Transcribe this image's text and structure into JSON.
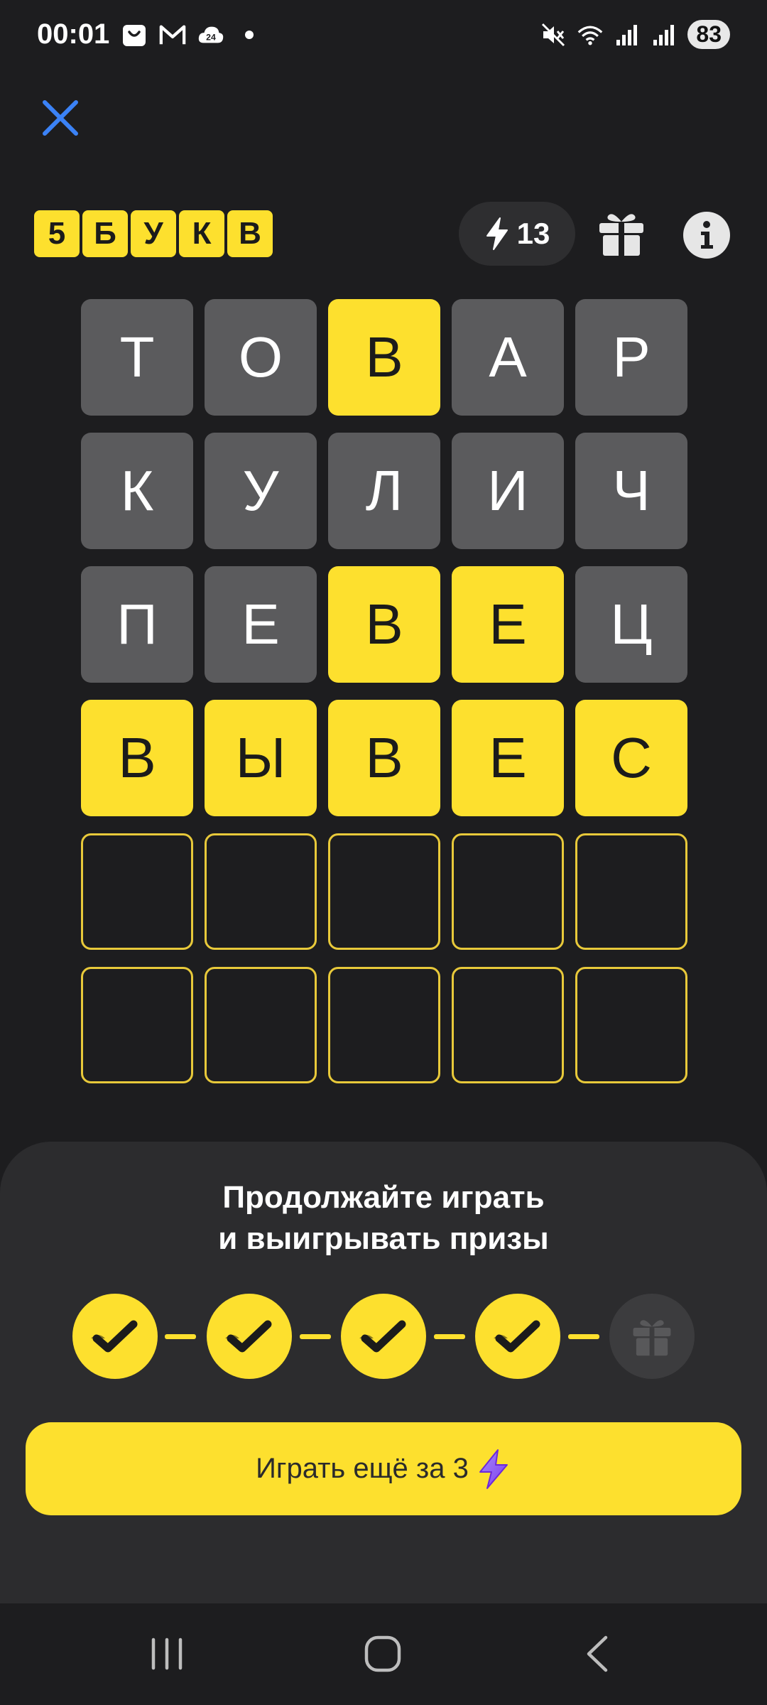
{
  "status": {
    "time": "00:01",
    "left_icons": [
      "shopping-bag-icon",
      "gmail-icon",
      "cloud-24-icon",
      "dot-icon"
    ],
    "right_icons": [
      "mute-icon",
      "wifi-icon",
      "signal-icon",
      "signal-icon"
    ],
    "battery": "83"
  },
  "header": {
    "logo_letters": [
      "5",
      "Б",
      "У",
      "К",
      "В"
    ],
    "energy_count": "13",
    "icons": [
      "close-icon",
      "lightning-icon",
      "gift-icon",
      "info-icon"
    ]
  },
  "grid": {
    "rows": [
      [
        {
          "letter": "Т",
          "state": "absent"
        },
        {
          "letter": "О",
          "state": "absent"
        },
        {
          "letter": "В",
          "state": "present"
        },
        {
          "letter": "А",
          "state": "absent"
        },
        {
          "letter": "Р",
          "state": "absent"
        }
      ],
      [
        {
          "letter": "К",
          "state": "absent"
        },
        {
          "letter": "У",
          "state": "absent"
        },
        {
          "letter": "Л",
          "state": "absent"
        },
        {
          "letter": "И",
          "state": "absent"
        },
        {
          "letter": "Ч",
          "state": "absent"
        }
      ],
      [
        {
          "letter": "П",
          "state": "absent"
        },
        {
          "letter": "Е",
          "state": "absent"
        },
        {
          "letter": "В",
          "state": "present"
        },
        {
          "letter": "Е",
          "state": "present"
        },
        {
          "letter": "Ц",
          "state": "absent"
        }
      ],
      [
        {
          "letter": "В",
          "state": "present"
        },
        {
          "letter": "Ы",
          "state": "present"
        },
        {
          "letter": "В",
          "state": "present"
        },
        {
          "letter": "Е",
          "state": "present"
        },
        {
          "letter": "С",
          "state": "present"
        }
      ],
      [
        {
          "letter": "",
          "state": "empty"
        },
        {
          "letter": "",
          "state": "empty"
        },
        {
          "letter": "",
          "state": "empty"
        },
        {
          "letter": "",
          "state": "empty"
        },
        {
          "letter": "",
          "state": "empty"
        }
      ],
      [
        {
          "letter": "",
          "state": "empty"
        },
        {
          "letter": "",
          "state": "empty"
        },
        {
          "letter": "",
          "state": "empty"
        },
        {
          "letter": "",
          "state": "empty"
        },
        {
          "letter": "",
          "state": "empty"
        }
      ]
    ]
  },
  "sheet": {
    "title_line1": "Продолжайте играть",
    "title_line2": "и выигрывать призы",
    "progress_steps": [
      "done",
      "done",
      "done",
      "done",
      "gift"
    ],
    "play_label": "Играть ещё за 3"
  },
  "colors": {
    "accent": "#fde02e",
    "tile_absent": "#5b5b5d",
    "background": "#1d1d1f",
    "sheet": "#2c2c2e",
    "close": "#3b82f6"
  },
  "nav": {
    "icons": [
      "recent-apps-icon",
      "home-icon",
      "back-icon"
    ]
  }
}
